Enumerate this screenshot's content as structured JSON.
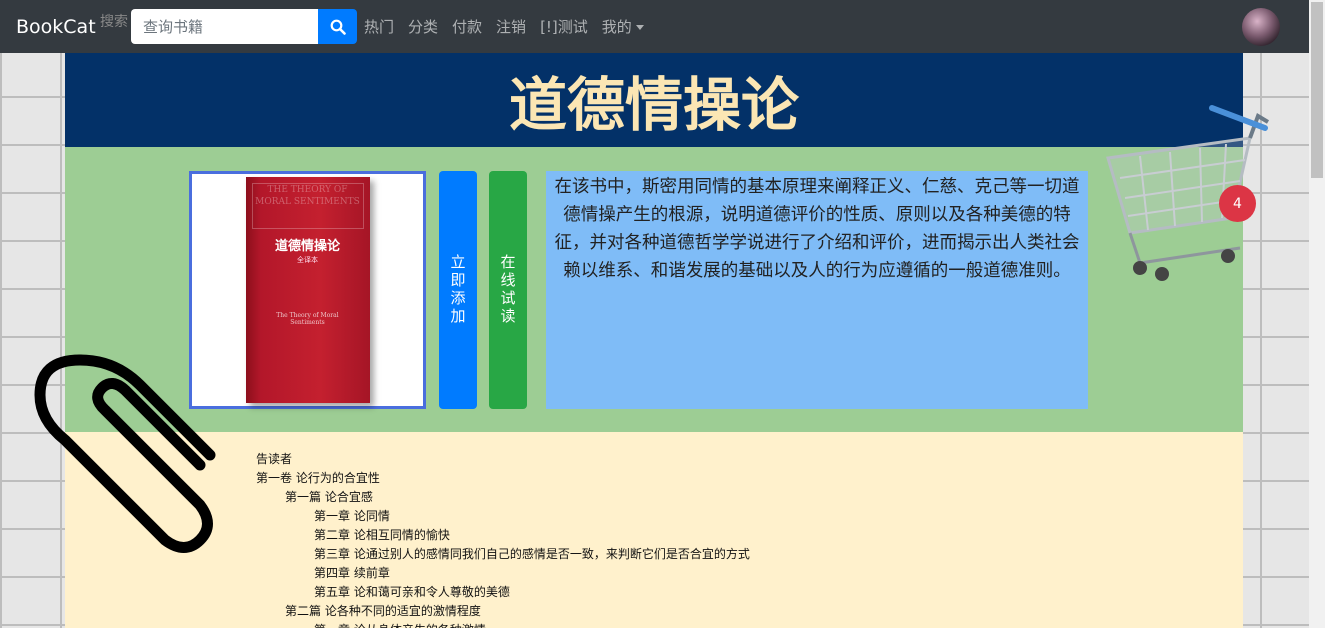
{
  "navbar": {
    "brand": "BookCat",
    "search_label": "搜索",
    "search_placeholder": "查询书籍",
    "links": [
      "热门",
      "分类",
      "付款",
      "注销",
      "[!]测试",
      "我的"
    ]
  },
  "book": {
    "title": "道德情操论",
    "cover_title": "道德情操论",
    "cover_subtitle": "全译本",
    "cover_top_text": "THE THEORY OF MORAL SENTIMENTS",
    "cover_mid_text": "The Theory of Moral Sentiments",
    "add_button": "立即添加",
    "try_button": "在线试读",
    "description": "在该书中，斯密用同情的基本原理来阐释正义、仁慈、克己等一切道德情操产生的根源，说明道德评价的性质、原则以及各种美德的特征，并对各种道德哲学学说进行了介绍和评价，进而揭示出人类社会赖以维系、和谐发展的基础以及人的行为应遵循的一般道德准则。"
  },
  "cart": {
    "count": "4"
  },
  "toc": [
    {
      "level": 1,
      "text": "告读者"
    },
    {
      "level": 1,
      "text": "第一卷  论行为的合宜性"
    },
    {
      "level": 2,
      "text": "第一篇  论合宜感"
    },
    {
      "level": 3,
      "text": "第一章  论同情"
    },
    {
      "level": 3,
      "text": "第二章  论相互同情的愉快"
    },
    {
      "level": 3,
      "text": "第三章  论通过别人的感情同我们自己的感情是否一致，来判断它们是否合宜的方式"
    },
    {
      "level": 3,
      "text": "第四章  续前章"
    },
    {
      "level": 3,
      "text": "第五章  论和蔼可亲和令人尊敬的美德"
    },
    {
      "level": 2,
      "text": "第二篇  论各种不同的适宜的激情程度"
    },
    {
      "level": 3,
      "text": "第一章  论从身体产生的各种激情"
    }
  ],
  "colors": {
    "navbar": "#343a40",
    "title_bar": "#033168",
    "title_text": "#fbe6b4",
    "info_bg": "#9dcd94",
    "desc_bg": "#7fbcf7",
    "toc_bg": "#fff1cc",
    "primary": "#007bff",
    "success": "#28a745",
    "badge": "#dc3545"
  }
}
